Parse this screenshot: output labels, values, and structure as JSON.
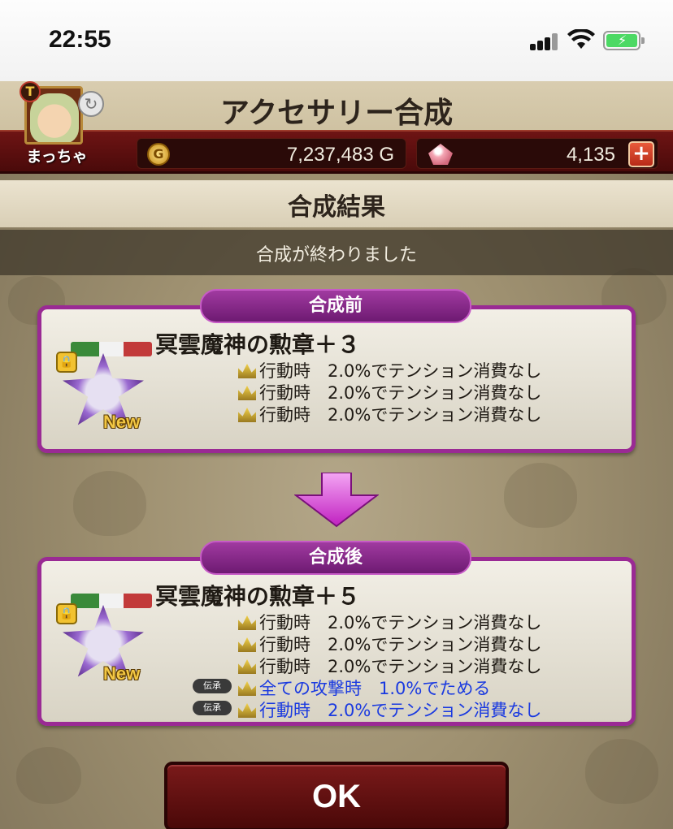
{
  "status_bar": {
    "time": "22:55"
  },
  "header": {
    "title": "アクセサリー合成",
    "player_name": "まっちゃ",
    "gold": "7,237,483 G",
    "gems": "4,135",
    "plus_label": "+"
  },
  "section": {
    "title": "合成結果",
    "message": "合成が終わりました"
  },
  "before": {
    "label": "合成前",
    "item_name": "冥雲魔神の勲章＋３",
    "new_label": "New",
    "effects": [
      "行動時　2.0%でテンション消費なし",
      "行動時　2.0%でテンション消費なし",
      "行動時　2.0%でテンション消費なし"
    ]
  },
  "after": {
    "label": "合成後",
    "item_name": "冥雲魔神の勲章＋５",
    "new_label": "New",
    "effects": [
      "行動時　2.0%でテンション消費なし",
      "行動時　2.0%でテンション消費なし",
      "行動時　2.0%でテンション消費なし"
    ],
    "inherit_tag": "伝承",
    "inherited_effects": [
      "全ての攻撃時　1.0%でためる",
      "行動時　2.0%でテンション消費なし"
    ]
  },
  "ok_button": "OK",
  "icons": [
    "lock-icon",
    "crown-icon",
    "gold-coin-icon",
    "gem-icon",
    "swap-icon",
    "down-arrow-icon"
  ],
  "colors": {
    "frame": "#9a2a94",
    "inherited_text": "#1a3ae0",
    "ok_button": "#6a1212"
  }
}
